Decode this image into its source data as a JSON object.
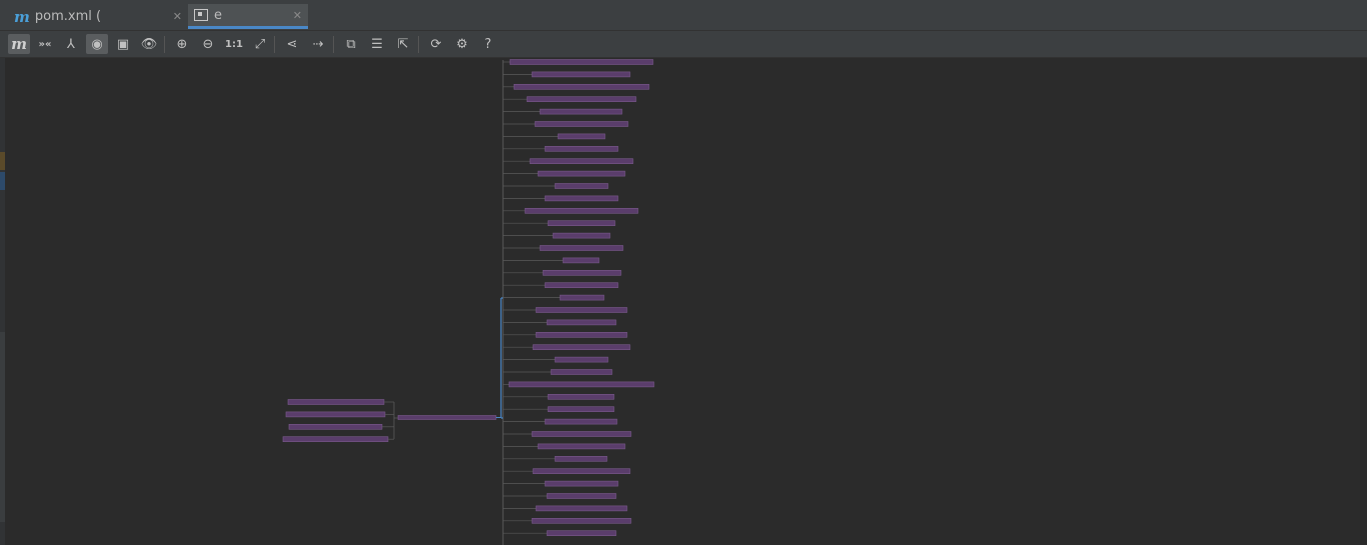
{
  "tabs": [
    {
      "label": "pom.xml (",
      "icon": "maven-m-icon",
      "active": false
    },
    {
      "label": "e",
      "icon": "diagram-icon",
      "active": true
    }
  ],
  "tab_m_glyph": "m",
  "close_glyph": "✕",
  "toolbar": {
    "items": [
      {
        "name": "maven-button",
        "glyph": "m",
        "active": true
      },
      {
        "name": "show-conflicts-button",
        "glyph": "»«",
        "active": false
      },
      {
        "name": "show-dependencies-button",
        "glyph": "⅄",
        "active": false
      },
      {
        "name": "highlight-button",
        "glyph": "◉",
        "active": true
      },
      {
        "name": "fit-content-button",
        "glyph": "▣",
        "active": false
      },
      {
        "name": "view-options-button",
        "glyph": "👁",
        "active": false
      },
      {
        "name": "zoom-in-button",
        "glyph": "⊕",
        "active": false
      },
      {
        "name": "zoom-out-button",
        "glyph": "⊖",
        "active": false
      },
      {
        "name": "actual-size-button",
        "glyph": "1:1",
        "active": false
      },
      {
        "name": "fit-page-button",
        "glyph": "⤢",
        "active": false
      },
      {
        "name": "layout-button",
        "glyph": "⋖",
        "active": false
      },
      {
        "name": "apply-layout-button",
        "glyph": "⇢",
        "active": false
      },
      {
        "name": "copy-button",
        "glyph": "⧉",
        "active": false
      },
      {
        "name": "export-button",
        "glyph": "☰",
        "active": false
      },
      {
        "name": "export-image-button",
        "glyph": "⇱",
        "active": false
      },
      {
        "name": "refresh-button",
        "glyph": "⟳",
        "active": false
      },
      {
        "name": "settings-button",
        "glyph": "⚙",
        "active": false
      },
      {
        "name": "help-button",
        "glyph": "?",
        "active": false
      }
    ]
  },
  "colors": {
    "background": "#2b2b2b",
    "node_fill": "#5a3d6b",
    "node_border": "#7a5a8c",
    "edge": "#5a5a5a",
    "highlight_edge": "#4a88c7",
    "accent": "#4a88c7"
  },
  "diagram": {
    "left_nodes": 4,
    "middle_nodes": 1,
    "right_nodes": 39
  }
}
